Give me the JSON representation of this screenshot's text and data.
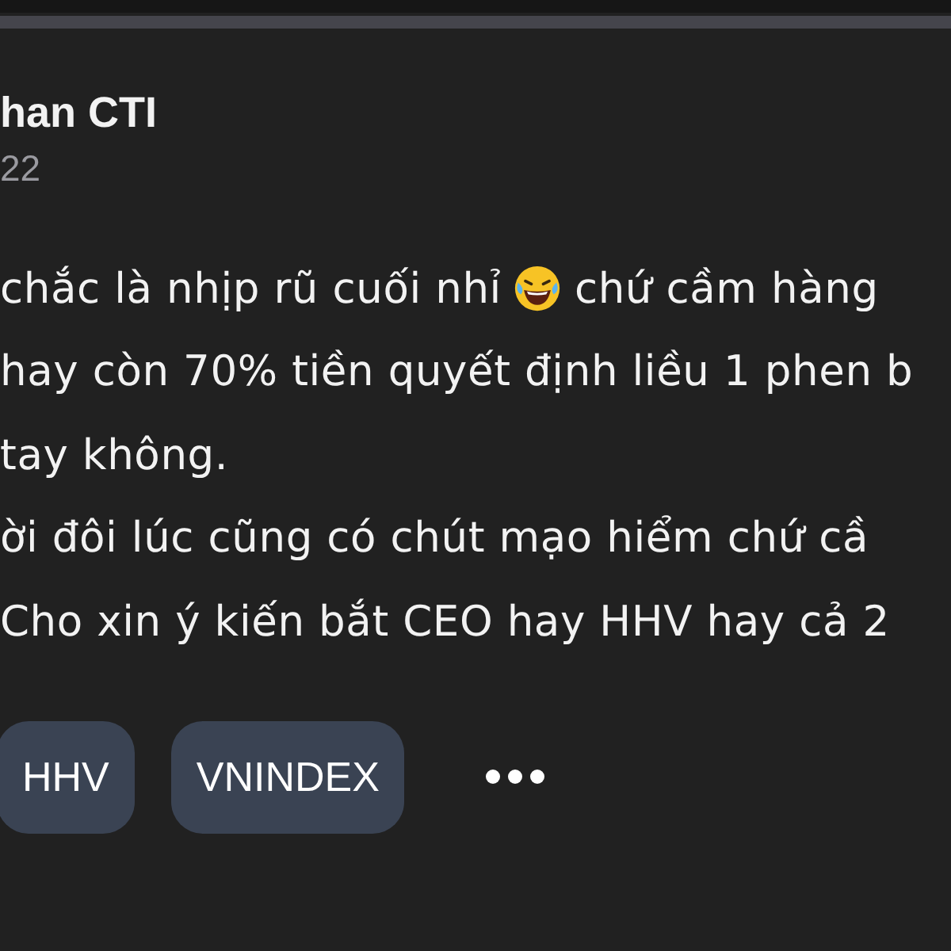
{
  "post": {
    "author": "han CTI",
    "time": "22",
    "lines": [
      {
        "parts": [
          {
            "kind": "text",
            "text": "chắc là nhịp rũ cuối nhỉ"
          },
          {
            "kind": "emoji"
          },
          {
            "kind": "text",
            "text": "chứ cầm hàng"
          }
        ]
      },
      {
        "parts": [
          {
            "kind": "text",
            "text": "hay còn 70% tiền quyết định liều 1 phen b"
          }
        ]
      },
      {
        "parts": [
          {
            "kind": "text",
            "text": "tay không."
          }
        ]
      },
      {
        "parts": [
          {
            "kind": "text",
            "text": "ời đôi lúc cũng có chút mạo hiểm chứ cầ"
          }
        ]
      },
      {
        "parts": [
          {
            "kind": "text",
            "text": "Cho xin ý kiến bắt CEO hay HHV hay cả 2"
          }
        ]
      }
    ],
    "tags": [
      "HHV",
      "VNINDEX"
    ]
  }
}
